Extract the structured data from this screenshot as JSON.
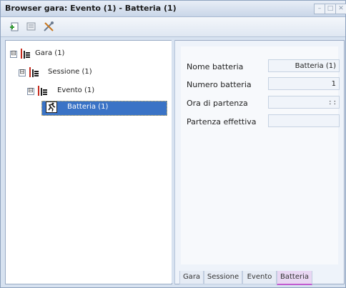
{
  "window": {
    "title": "Browser gara: Evento (1) - Batteria (1)"
  },
  "toolbar": {
    "buttons": [
      "add-icon",
      "edit-icon",
      "tools-icon"
    ]
  },
  "tree": {
    "nodes": [
      {
        "label": "Gara (1)",
        "expander": "⊟"
      },
      {
        "label": "Sessione (1)",
        "expander": "⊟"
      },
      {
        "label": "Evento (1)",
        "expander": "⊟"
      },
      {
        "label": "Batteria (1)",
        "expander": ""
      }
    ]
  },
  "properties": [
    {
      "label": "Nome batteria",
      "value": "Batteria (1)"
    },
    {
      "label": "Numero batteria",
      "value": "1"
    },
    {
      "label": "Ora di partenza",
      "value": ": :"
    },
    {
      "label": "Partenza effettiva",
      "value": ""
    }
  ],
  "tabs": [
    "Gara",
    "Sessione",
    "Evento",
    "Batteria"
  ],
  "active_tab": "Batteria",
  "colors": {
    "selection": "#3a73c6",
    "active_tab_accent": "#c15bd0",
    "tree_icon_red": "#c62b1e"
  }
}
